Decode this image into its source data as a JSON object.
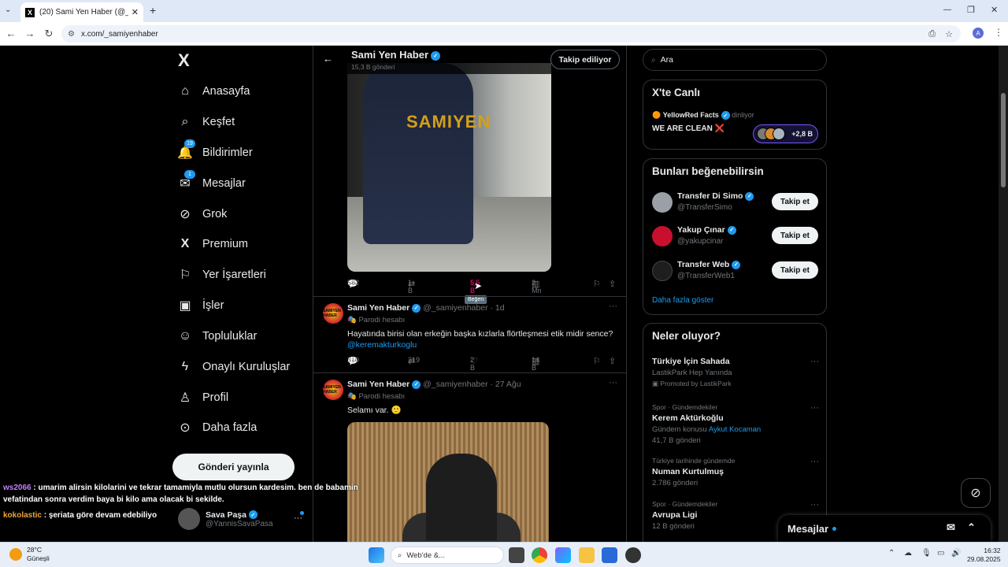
{
  "browser": {
    "tab_title": "(20) Sami Yen Haber (@_samiy...",
    "tab_close": "✕",
    "new_tab": "+",
    "url": "x.com/_samiyenhaber",
    "profile_initial": "A",
    "window_min": "—",
    "window_max": "❐",
    "window_close": "✕"
  },
  "sidebar": {
    "logo": "X",
    "items": [
      {
        "label": "Anasayfa",
        "icon": "home-icon"
      },
      {
        "label": "Keşfet",
        "icon": "search-icon"
      },
      {
        "label": "Bildirimler",
        "icon": "bell-icon",
        "badge": "19"
      },
      {
        "label": "Mesajlar",
        "icon": "mail-icon",
        "badge": "1"
      },
      {
        "label": "Grok",
        "icon": "grok-icon"
      },
      {
        "label": "Premium",
        "icon": "x-icon"
      },
      {
        "label": "Yer İşaretleri",
        "icon": "bookmark-icon"
      },
      {
        "label": "İşler",
        "icon": "briefcase-icon"
      },
      {
        "label": "Topluluklar",
        "icon": "people-icon"
      },
      {
        "label": "Onaylı Kuruluşlar",
        "icon": "lightning-icon"
      },
      {
        "label": "Profil",
        "icon": "person-icon"
      },
      {
        "label": "Daha fazla",
        "icon": "more-circle-icon"
      }
    ],
    "post_button": "Gönderi yayınla",
    "account": {
      "name": "Sava Paşa",
      "handle": "@YannisSavaPasa",
      "more": "···"
    }
  },
  "chat_overlay": [
    {
      "user": "ws2066",
      "sep": " : ",
      "msg": "umarim alirsin kilolarini ve tekrar tamamiyla mutlu olursun kardesim. ben de babamin vefatindan sonra verdim baya bi kilo ama olacak bi sekilde."
    },
    {
      "user": "kokolastic",
      "sep": " : ",
      "msg": "şeriata göre devam edebiliyo"
    }
  ],
  "profile_header": {
    "name": "Sami Yen Haber",
    "post_count": "15,3 B gönderi",
    "follow_button": "Takip ediliyor",
    "back": "←"
  },
  "tweet0": {
    "watermark": "SAMIYEN",
    "replies": "582",
    "retweets": "1 B",
    "likes": "5,5 B",
    "views": "2 Mn",
    "tooltip": "Beğen"
  },
  "tweets": [
    {
      "name": "Sami Yen Haber",
      "handle": "@_samiyenhaber",
      "sep": " · ",
      "time": "1d",
      "label": "Parodi hesabı",
      "text": "Hayatında birisi olan erkeğin başka kızlarla flörtleşmesi etik midir sence?",
      "mention": "@keremakturkoglu",
      "replies": "310",
      "retweets": "319",
      "likes": "2 B",
      "views": "14 B"
    },
    {
      "name": "Sami Yen Haber",
      "handle": "@_samiyenhaber",
      "sep": " · ",
      "time": "27 Ağu",
      "label": "Parodi hesabı",
      "text": "Selamı var. 🙂"
    }
  ],
  "avatar_text": "SAMIYEN HABER",
  "right": {
    "search_placeholder": "Ara",
    "live": {
      "title": "X'te Canlı",
      "host": "YellowRed Facts",
      "status": "dinliyor",
      "space_title": "WE ARE CLEAN",
      "space_mark": "❌",
      "listeners": "+2,8 B"
    },
    "suggest": {
      "title": "Bunları beğenebilirsin",
      "follow_label": "Takip et",
      "users": [
        {
          "name": "Transfer Di Simo",
          "handle": "@TransferSimo"
        },
        {
          "name": "Yakup Çınar",
          "handle": "@yakupcinar"
        },
        {
          "name": "Transfer Web",
          "handle": "@TransferWeb1"
        }
      ],
      "show_more": "Daha fazla göster"
    },
    "trends": {
      "title": "Neler oluyor?",
      "items": [
        {
          "name": "Türkiye İçin Sahada",
          "meta": "LastikPark Hep Yanında",
          "meta2": "Promoted by LastikPark"
        },
        {
          "ctx": "Spor · Gündemdekiler",
          "name": "Kerem Aktürkoğlu",
          "meta": "Gündem konusu",
          "link": "Aykut Kocaman",
          "meta2": "41,7 B gönderi"
        },
        {
          "ctx": "Türkiye tarihinde gündemde",
          "name": "Numan Kurtulmuş",
          "meta": "2.786 gönderi"
        },
        {
          "ctx": "Spor · Gündemdekiler",
          "name": "Avrupa Ligi",
          "meta": "12 B gönderi"
        }
      ]
    },
    "messages_dock": "Mesajlar"
  },
  "taskbar": {
    "temp": "28°C",
    "weather": "Güneşli",
    "search": "Web'de &...",
    "time": "16:32",
    "date": "29.08.2025"
  },
  "colors": {
    "accent": "#1d9bf0",
    "like_active": "#f91880",
    "background": "#000000",
    "border": "#2f3336",
    "muted": "#71767b"
  }
}
